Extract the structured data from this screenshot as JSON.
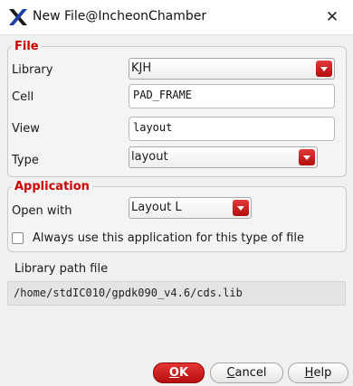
{
  "window": {
    "title": "New File@IncheonChamber",
    "close_glyph": "✕"
  },
  "file_group": {
    "title": "File",
    "library_label": "Library",
    "library_value": "KJH",
    "cell_label": "Cell",
    "cell_value": "PAD_FRAME",
    "view_label": "View",
    "view_value": "layout",
    "type_label": "Type",
    "type_value": "layout"
  },
  "application_group": {
    "title": "Application",
    "open_with_label": "Open with",
    "open_with_value": "Layout L",
    "always_use_label": "Always use this application for this type of file",
    "always_use_checked": false
  },
  "library_path": {
    "label": "Library path file",
    "value": "/home/stdIC010/gpdk090_v4.6/cds.lib"
  },
  "buttons": {
    "ok": {
      "label": "OK",
      "mnemonic": "O",
      "rest": "K"
    },
    "cancel": {
      "label": "Cancel",
      "mnemonic": "C",
      "rest": "ancel"
    },
    "help": {
      "label": "Help",
      "mnemonic": "H",
      "rest": "elp"
    }
  },
  "colors": {
    "accent_red": "#cc0000",
    "button_red": "#c81e1e",
    "background": "#f0f0f0"
  },
  "icons": {
    "app": "x-logo-icon",
    "close": "close-icon",
    "dropdown": "dropdown-arrow-icon"
  }
}
